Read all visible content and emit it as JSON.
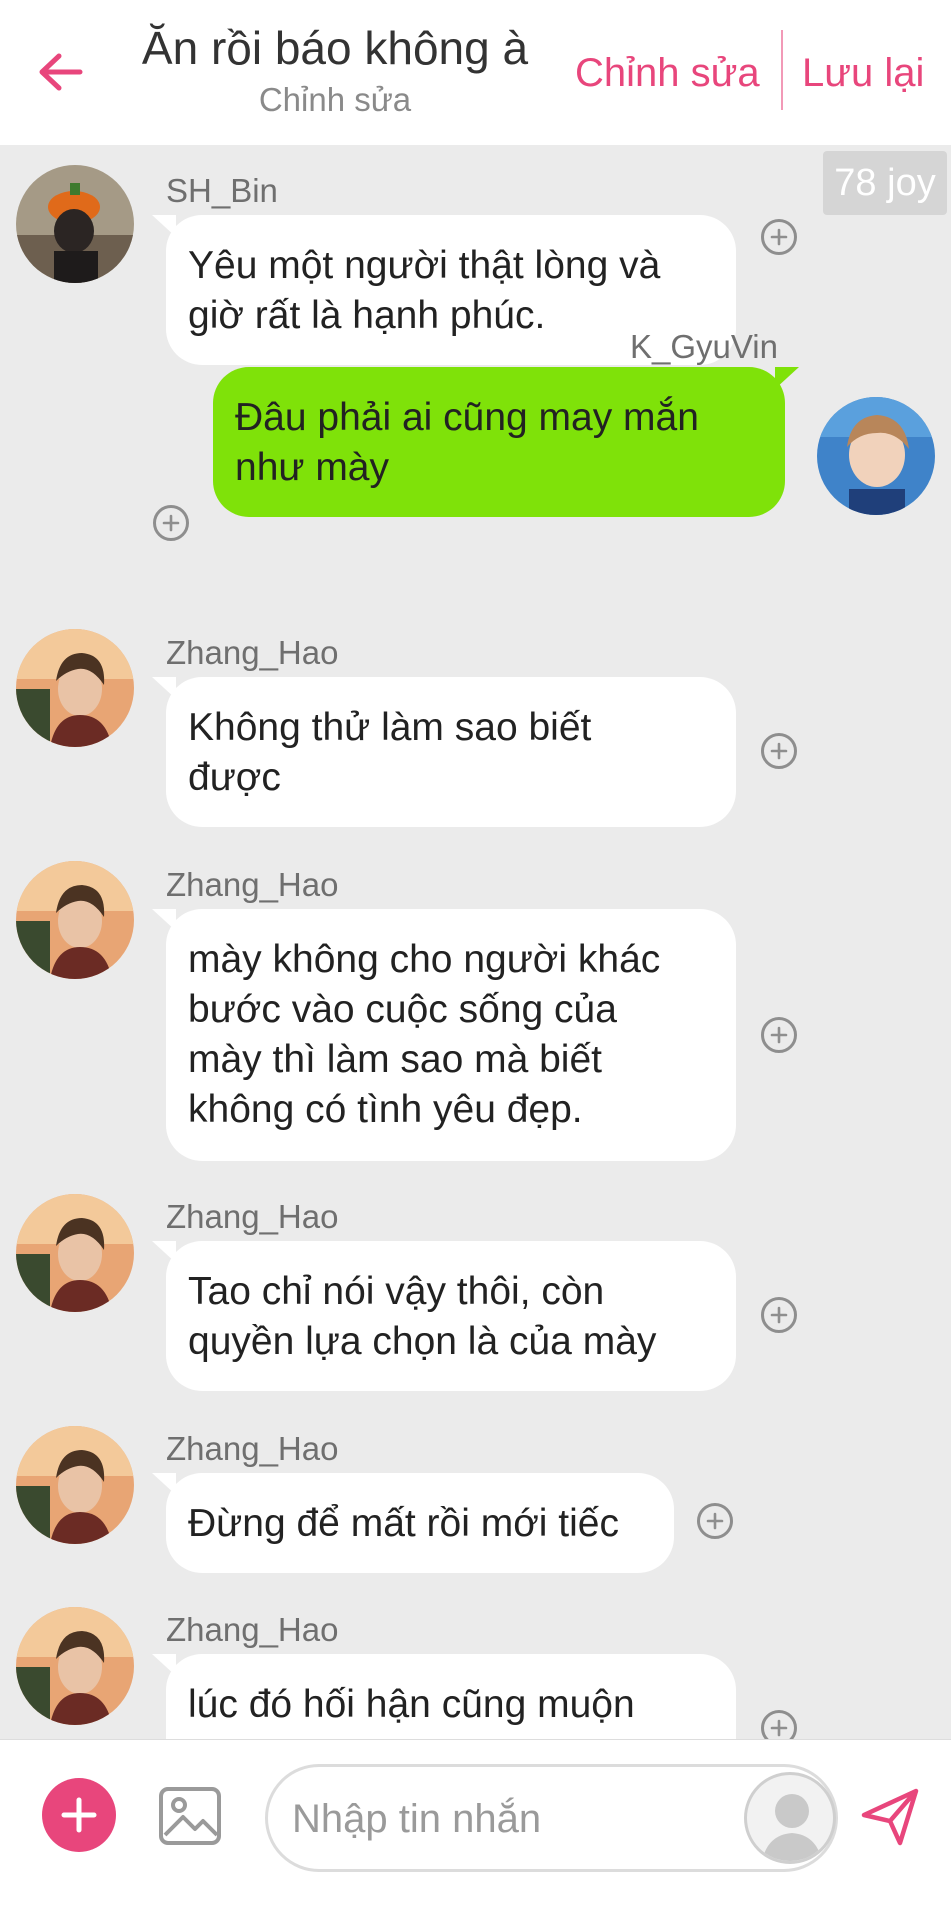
{
  "header": {
    "title": "Ăn rồi báo không à",
    "subtitle": "Chỉnh sửa",
    "edit_label": "Chỉnh sửa",
    "save_label": "Lưu lại",
    "back_icon": "arrow-left-icon",
    "accent_color": "#e8467c"
  },
  "joy_badge": "78 joy",
  "messages": [
    {
      "sender": "SH_Bin",
      "side": "left",
      "lines": [
        "Yêu một người thật lòng và",
        "giờ rất là hạnh phúc."
      ]
    },
    {
      "sender": "K_GyuVin",
      "side": "right",
      "lines": [
        "Đâu phải ai cũng may mắn",
        "như mày"
      ]
    },
    {
      "sender": "Zhang_Hao",
      "side": "left",
      "lines": [
        "Không thử làm sao biết",
        "được"
      ]
    },
    {
      "sender": "Zhang_Hao",
      "side": "left",
      "lines": [
        "mày không cho người khác",
        "bước vào cuộc sống của",
        "mày thì làm sao mà biết",
        "không có tình yêu đẹp."
      ]
    },
    {
      "sender": "Zhang_Hao",
      "side": "left",
      "lines": [
        "Tao chỉ nói vậy thôi, còn",
        "quyền lựa chọn là của mày"
      ]
    },
    {
      "sender": "Zhang_Hao",
      "side": "left",
      "lines": [
        "Đừng để mất rồi mới tiếc"
      ]
    },
    {
      "sender": "Zhang_Hao",
      "side": "left",
      "lines": [
        "lúc đó hối hận cũng muộn"
      ]
    }
  ],
  "composer": {
    "placeholder": "Nhập tin nhắn",
    "add_icon": "plus-icon",
    "image_icon": "image-icon",
    "send_icon": "send-icon",
    "persona_icon": "user-silhouette-icon"
  },
  "colors": {
    "own_bubble": "#7fe209",
    "other_bubble": "#ffffff",
    "chat_background": "#ebebeb"
  }
}
